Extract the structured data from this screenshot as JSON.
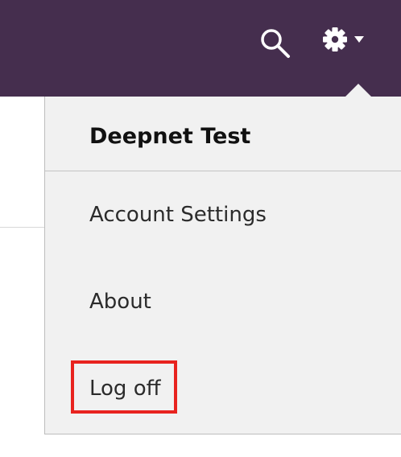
{
  "header": {
    "search_icon": "search-icon",
    "settings_icon": "gear-icon",
    "dropdown_icon": "caret-down-icon",
    "colors": {
      "bar": "#452e4e",
      "icon": "#ffffff"
    }
  },
  "menu": {
    "title": "Deepnet Test",
    "items": [
      {
        "label": "Account Settings"
      },
      {
        "label": "About"
      },
      {
        "label": "Log off"
      }
    ],
    "colors": {
      "background": "#f1f1f1",
      "highlight": "#e8231f"
    }
  }
}
